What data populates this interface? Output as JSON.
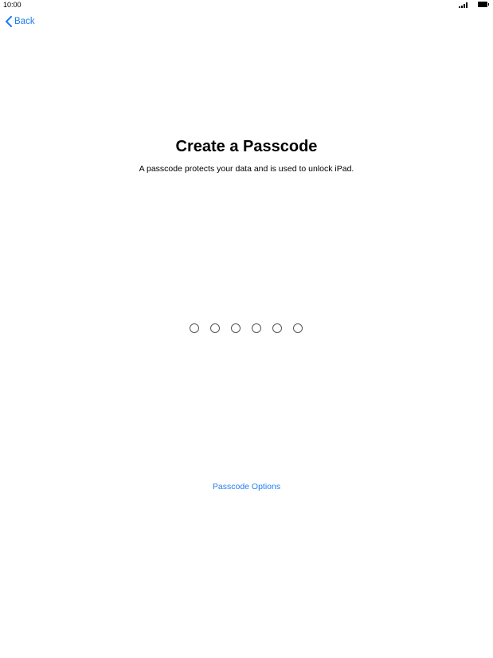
{
  "status_bar": {
    "time": "10:00",
    "signal_icon": "cellular-signal-icon",
    "battery_icon": "battery-full-icon"
  },
  "nav": {
    "back_label": "Back",
    "back_icon": "chevron-left-icon"
  },
  "main": {
    "title": "Create a Passcode",
    "subtitle": "A passcode protects your data and is used to unlock iPad.",
    "passcode_digits_total": 6,
    "passcode_digits_entered": 0,
    "options_label": "Passcode Options"
  },
  "colors": {
    "accent": "#1e7cf2",
    "background": "#ffffff",
    "text": "#000000"
  }
}
